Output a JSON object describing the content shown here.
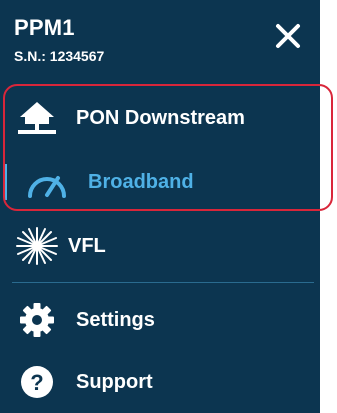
{
  "header": {
    "title": "PPM1",
    "serial": "S.N.: 1234567",
    "close_icon": "close-icon"
  },
  "menu": {
    "items": [
      {
        "label": "PON Downstream",
        "icon": "pon-downstream-icon",
        "active": false
      },
      {
        "label": "Broadband",
        "icon": "gauge-icon",
        "active": true
      },
      {
        "label": "VFL",
        "icon": "laser-burst-icon",
        "active": false
      },
      {
        "label": "Settings",
        "icon": "gear-icon",
        "active": false
      },
      {
        "label": "Support",
        "icon": "help-icon",
        "active": false
      }
    ]
  },
  "colors": {
    "background": "#0c3550",
    "accent": "#4fb1e6",
    "text": "#ffffff",
    "divider": "#2a6b8f",
    "annotation_frame": "#d9263a"
  }
}
